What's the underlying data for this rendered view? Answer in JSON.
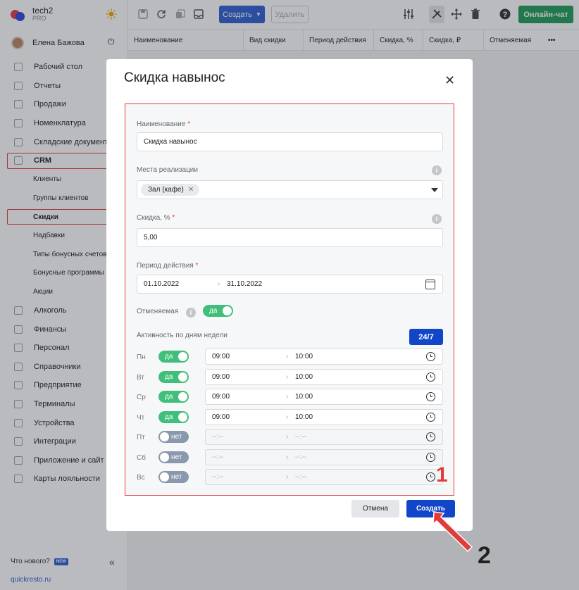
{
  "app": {
    "name": "tech2",
    "plan": "PRO"
  },
  "user": {
    "name": "Елена Бажова"
  },
  "sidebar": {
    "items": [
      {
        "label": "Рабочий стол",
        "sub": false
      },
      {
        "label": "Отчеты",
        "sub": false
      },
      {
        "label": "Продажи",
        "sub": false
      },
      {
        "label": "Номенклатура",
        "sub": false
      },
      {
        "label": "Складские документы",
        "sub": false
      },
      {
        "label": "CRM",
        "sub": false
      },
      {
        "label": "Клиенты",
        "sub": true
      },
      {
        "label": "Группы клиентов",
        "sub": true
      },
      {
        "label": "Скидки",
        "sub": true
      },
      {
        "label": "Надбавки",
        "sub": true
      },
      {
        "label": "Типы бонусных счетов",
        "sub": true
      },
      {
        "label": "Бонусные программы",
        "sub": true
      },
      {
        "label": "Акции",
        "sub": true
      },
      {
        "label": "Алкоголь",
        "sub": false
      },
      {
        "label": "Финансы",
        "sub": false
      },
      {
        "label": "Персонал",
        "sub": false
      },
      {
        "label": "Справочники",
        "sub": false
      },
      {
        "label": "Предприятие",
        "sub": false
      },
      {
        "label": "Терминалы",
        "sub": false
      },
      {
        "label": "Устройства",
        "sub": false
      },
      {
        "label": "Интеграции",
        "sub": false
      },
      {
        "label": "Приложение и сайт",
        "sub": false
      },
      {
        "label": "Карты лояльности",
        "sub": false
      }
    ],
    "whats_new": "Что нового?",
    "new_badge": "NEW",
    "site": "quickresto.ru"
  },
  "toolbar": {
    "create_label": "Создать",
    "delete_label": "Удалить",
    "chat_label": "Онлайн-чат"
  },
  "table": {
    "columns": [
      "Наименование",
      "Вид скидки",
      "Период действия",
      "Скидка, %",
      "Скидка, ₽",
      "Отменяемая"
    ],
    "more": "•••"
  },
  "modal": {
    "title": "Скидка навынос",
    "name_label": "Наименование",
    "name_value": "Скидка навынос",
    "places_label": "Места реализации",
    "place_tag": "Зал (кафе)",
    "discount_label": "Скидка, %",
    "discount_value": "5,00",
    "period_label": "Период действия",
    "period_from": "01.10.2022",
    "period_to": "31.10.2022",
    "cancelable_label": "Отменяемая",
    "cancelable_toggle": "да",
    "weekdays_label": "Активность по дням недели",
    "btn_247": "24/7",
    "days": [
      {
        "day": "Пн",
        "state": "да",
        "on": true,
        "from": "09:00",
        "to": "10:00"
      },
      {
        "day": "Вт",
        "state": "да",
        "on": true,
        "from": "09:00",
        "to": "10:00"
      },
      {
        "day": "Ср",
        "state": "да",
        "on": true,
        "from": "09:00",
        "to": "10:00"
      },
      {
        "day": "Чт",
        "state": "да",
        "on": true,
        "from": "09:00",
        "to": "10:00"
      },
      {
        "day": "Пт",
        "state": "нет",
        "on": false,
        "from": "--:--",
        "to": "--:--"
      },
      {
        "day": "Сб",
        "state": "нет",
        "on": false,
        "from": "--:--",
        "to": "--:--"
      },
      {
        "day": "Вс",
        "state": "нет",
        "on": false,
        "from": "--:--",
        "to": "--:--"
      }
    ],
    "cancel_label": "Отмена",
    "create_label": "Создать"
  },
  "annotations": {
    "step1": "1",
    "step2": "2"
  },
  "colors": {
    "primary": "#1246c8",
    "toggle_on": "#3fbf7a",
    "toggle_off": "#8a98ad",
    "highlight": "#e23b3b",
    "chat": "#1f9d57"
  }
}
